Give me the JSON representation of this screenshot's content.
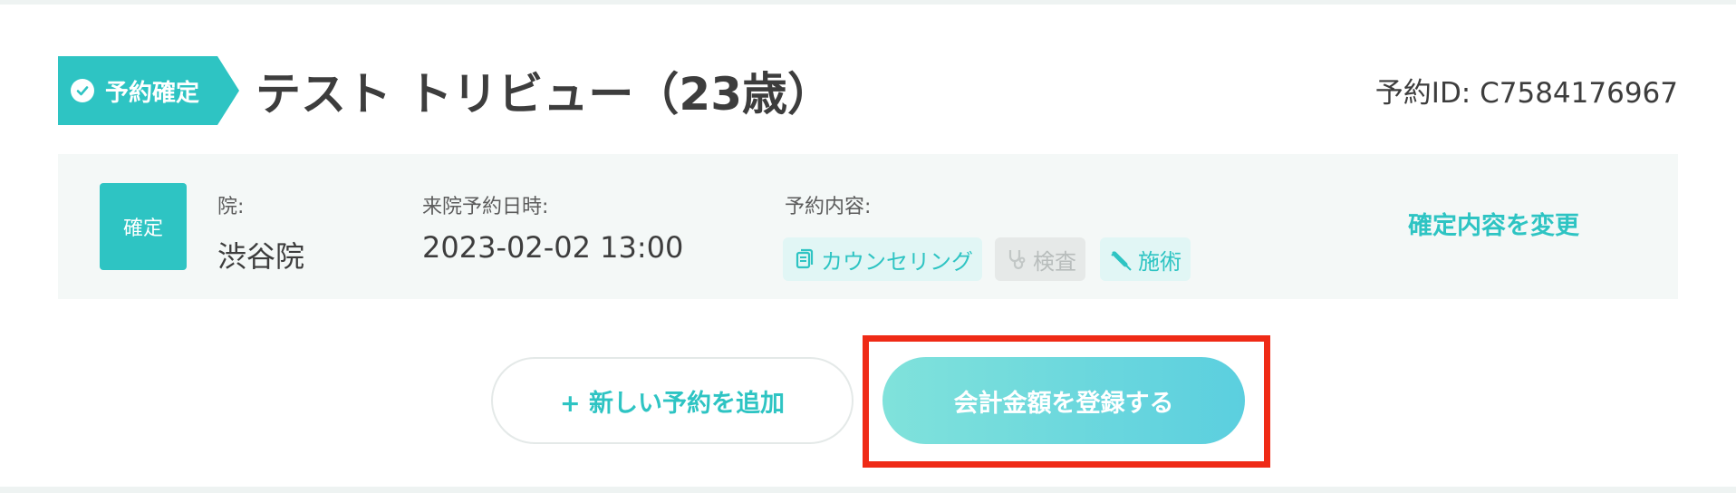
{
  "header": {
    "badge_label": "予約確定",
    "patient_name": "テスト トリビュー（23歳）",
    "reservation_id": "予約ID: C7584176967"
  },
  "panel": {
    "status_label": "確定",
    "clinic_label": "院:",
    "clinic_value": "渋谷院",
    "datetime_label": "来院予約日時:",
    "datetime_value": "2023-02-02 13:00",
    "content_label": "予約内容:",
    "tags": [
      {
        "label": "カウンセリング",
        "icon": "document-icon",
        "active": true
      },
      {
        "label": "検査",
        "icon": "stethoscope-icon",
        "active": false
      },
      {
        "label": "施術",
        "icon": "syringe-icon",
        "active": true
      }
    ],
    "change_link": "確定内容を変更"
  },
  "actions": {
    "add_reservation": "+ 新しい予約を追加",
    "register_amount": "会計金額を登録する"
  },
  "colors": {
    "accent": "#2ec4c3",
    "highlight": "#ef2a16",
    "panel_bg": "#f4f8f7"
  }
}
